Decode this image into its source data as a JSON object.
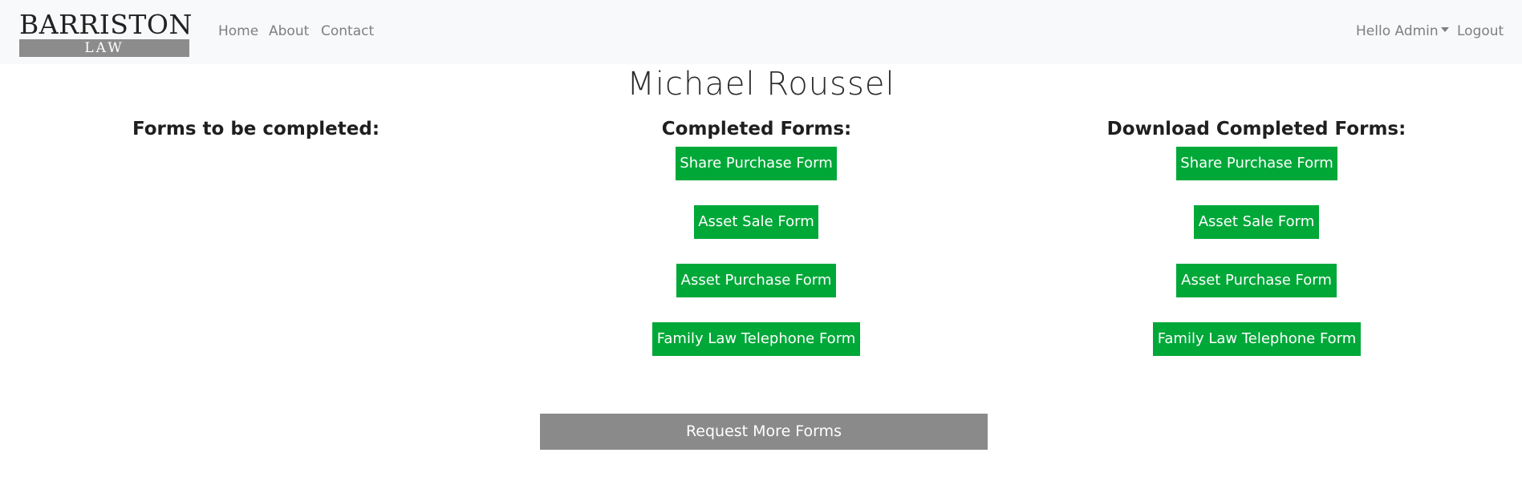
{
  "brand": {
    "top": "BARRISTON",
    "bottom": "LAW"
  },
  "nav": {
    "links": [
      "Home",
      "About",
      "Contact"
    ],
    "user_menu": "Hello Admin",
    "logout": "Logout"
  },
  "client": {
    "name": "Michael Roussel"
  },
  "columns": {
    "to_complete": {
      "heading": "Forms to be completed:"
    },
    "completed": {
      "heading": "Completed Forms:",
      "forms": [
        "Share Purchase Form",
        "Asset Sale Form",
        "Asset Purchase Form",
        "Family Law Telephone Form"
      ]
    },
    "download": {
      "heading": "Download Completed Forms:",
      "forms": [
        "Share Purchase Form",
        "Asset Sale Form",
        "Asset Purchase Form",
        "Family Law Telephone Form"
      ]
    }
  },
  "actions": {
    "request_more": "Request More Forms"
  },
  "colors": {
    "navbar_bg": "#f8f9fa",
    "form_button": "#00a838",
    "request_button": "#8a8a8a"
  }
}
